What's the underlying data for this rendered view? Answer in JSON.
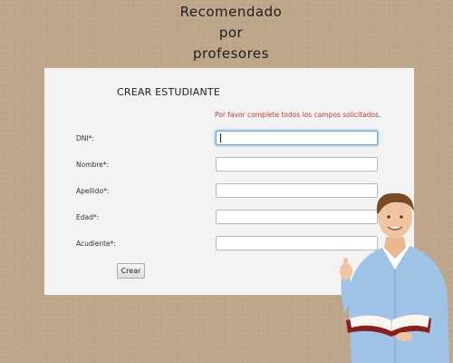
{
  "tagline": [
    "Recomendado",
    "por",
    "profesores"
  ],
  "form": {
    "title": "CREAR ESTUDIANTE",
    "message": "Por favor complete todos los campos solicitados.",
    "fields": [
      {
        "label": "DNI*:",
        "value": "",
        "focused": true
      },
      {
        "label": "Nombre*:",
        "value": ""
      },
      {
        "label": "Apellido*:",
        "value": ""
      },
      {
        "label": "Edad*:",
        "value": ""
      },
      {
        "label": "Acudiente*:",
        "value": ""
      }
    ],
    "submit_label": "Crear"
  },
  "colors": {
    "background": "#bea68a",
    "panel": "#f3f3f3",
    "error_text": "#c0392b",
    "focus_border": "#6aa6d8"
  },
  "illustration": {
    "name": "teacher-with-book-image"
  }
}
